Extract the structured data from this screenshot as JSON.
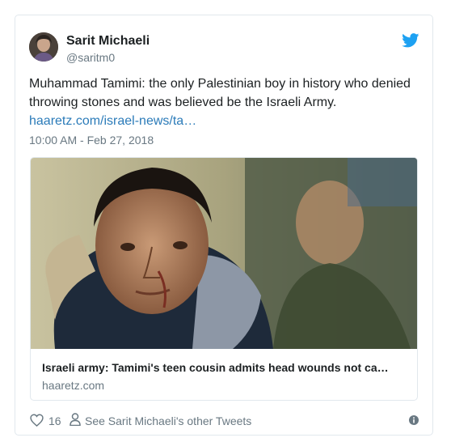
{
  "tweet": {
    "author_name": "Sarit Michaeli",
    "author_handle": "@saritm0",
    "text_line1": "Muhammad Tamimi: the only Palestinian boy in history who denied",
    "text_line2": "throwing stones and was believed be the Israeli Army.",
    "link": "haaretz.com/israel-news/ta…",
    "timestamp": "10:00 AM - Feb 27, 2018"
  },
  "card": {
    "title": "Israeli army: Tamimi's teen cousin admits head wounds not ca…",
    "domain": "haaretz.com"
  },
  "footer": {
    "likes": "16",
    "other_tweets": "See Sarit Michaeli's other Tweets"
  },
  "icons": {
    "brand": "twitter-bird-icon",
    "like": "heart-icon",
    "profile": "person-icon",
    "info": "info-icon"
  },
  "colors": {
    "brand": "#1da1f2",
    "link": "#2b7bb9",
    "muted": "#697882"
  }
}
